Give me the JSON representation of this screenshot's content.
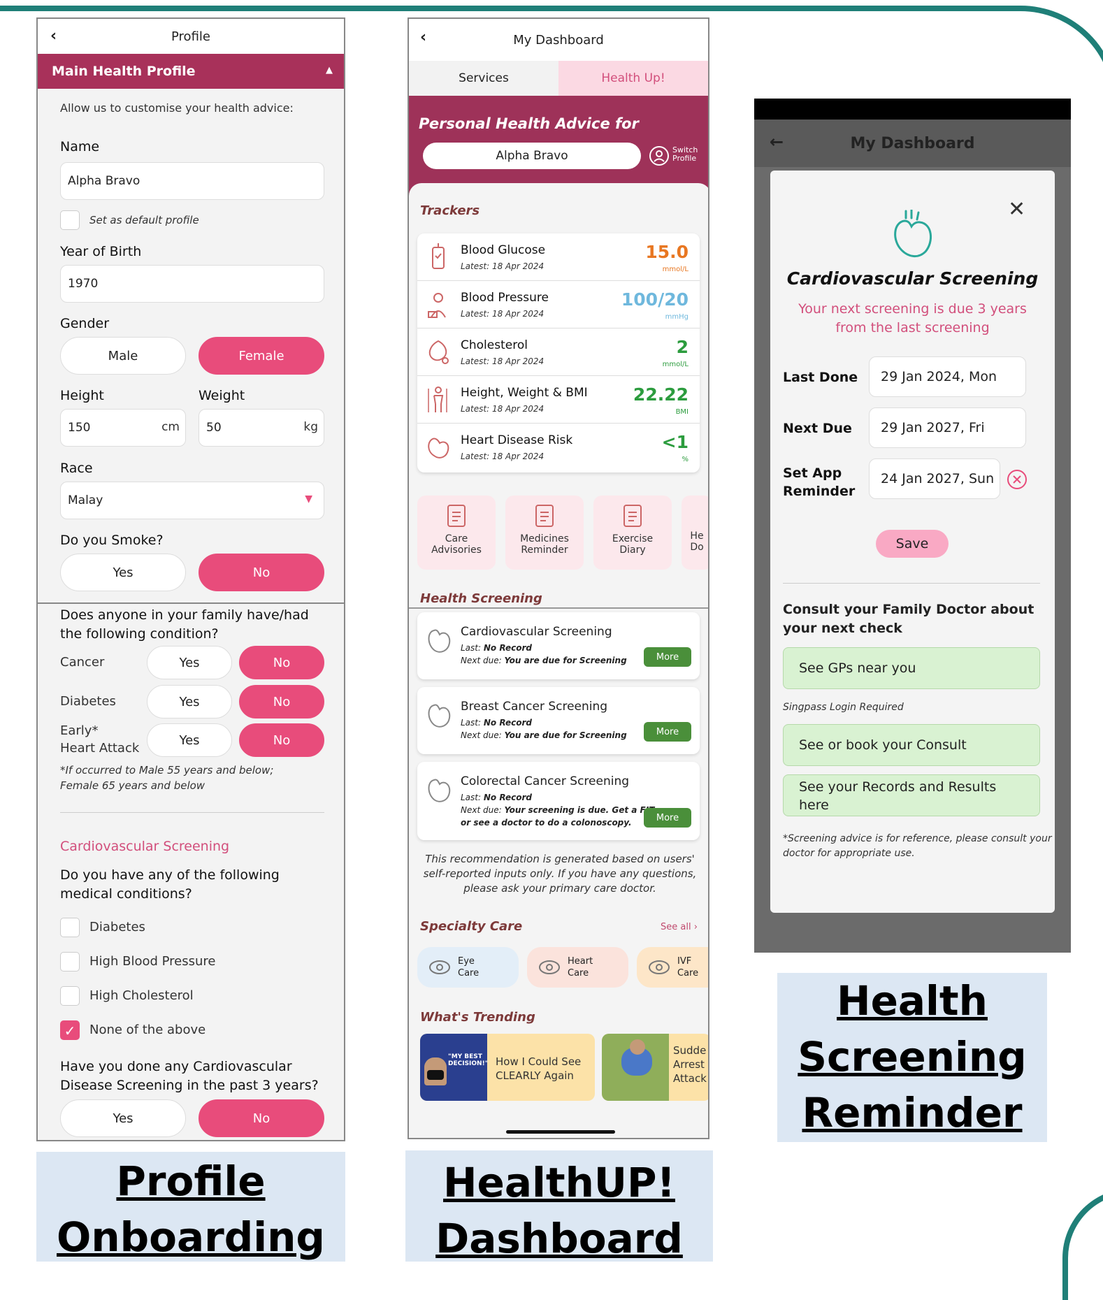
{
  "profile": {
    "title": "Profile",
    "section": "Main Health Profile",
    "intro": "Allow us to customise your health advice:",
    "name_label": "Name",
    "name_value": "Alpha Bravo",
    "default_label": "Set as default profile",
    "yob_label": "Year of Birth",
    "yob_value": "1970",
    "gender_label": "Gender",
    "gender_male": "Male",
    "gender_female": "Female",
    "height_label": "Height",
    "height_value": "150",
    "height_unit": "cm",
    "weight_label": "Weight",
    "weight_value": "50",
    "weight_unit": "kg",
    "race_label": "Race",
    "race_value": "Malay",
    "smoke_label": "Do you Smoke?",
    "yes": "Yes",
    "no": "No",
    "family_q": "Does anyone in your family have/had the following condition?",
    "fam_cancer": "Cancer",
    "fam_diabetes": "Diabetes",
    "fam_early": "Early*",
    "fam_heart": "Heart Attack",
    "fam_note1": "*If occurred to Male 55 years and below;",
    "fam_note2": "Female 65 years and below",
    "cv_title": "Cardiovascular Screening",
    "cond_q1": "Do you have any of the following",
    "cond_q2": "medical conditions?",
    "cond_diabetes": "Diabetes",
    "cond_hbp": "High Blood Pressure",
    "cond_chol": "High Cholesterol",
    "cond_none": "None of the above",
    "done_q1": "Have you done any Cardiovascular",
    "done_q2": "Disease Screening in the past 3 years?"
  },
  "captions": {
    "c1a": "Profile",
    "c1b": "Onboarding",
    "c2a": "HealthUP!",
    "c2b": "Dashboard",
    "c3a": "Health",
    "c3b": "Screening",
    "c3c": "Reminder"
  },
  "dashboard": {
    "title": "My Dashboard",
    "tab_services": "Services",
    "tab_healthup": "Health Up!",
    "advice_title": "Personal Health Advice for",
    "profile_name": "Alpha Bravo",
    "switch1": "Switch",
    "switch2": "Profile",
    "trackers_title": "Trackers",
    "trackers": [
      {
        "name": "Blood Glucose",
        "date": "Latest: 18 Apr 2024",
        "value": "15.0",
        "unit": "mmol/L",
        "color": "#e87722"
      },
      {
        "name": "Blood Pressure",
        "date": "Latest: 18 Apr 2024",
        "value": "100/20",
        "unit": "mmHg",
        "color": "#6fb8dd"
      },
      {
        "name": "Cholesterol",
        "date": "Latest: 18 Apr 2024",
        "value": "2",
        "unit": "mmol/L",
        "color": "#2c9c3e"
      },
      {
        "name": "Height, Weight & BMI",
        "date": "Latest: 18 Apr 2024",
        "value": "22.22",
        "unit": "BMI",
        "color": "#2c9c3e"
      },
      {
        "name": "Heart Disease Risk",
        "date": "Latest: 18 Apr 2024",
        "value": "<1",
        "unit": "%",
        "color": "#2c9c3e"
      }
    ],
    "tiles": [
      {
        "l1": "Care",
        "l2": "Advisories"
      },
      {
        "l1": "Medicines",
        "l2": "Reminder"
      },
      {
        "l1": "Exercise",
        "l2": "Diary"
      },
      {
        "l1": "He",
        "l2": "Do"
      }
    ],
    "screening_title": "Health Screening",
    "screenings": [
      {
        "name": "Cardiovascular Screening",
        "last_k": "Last:",
        "last_v": "No Record",
        "next_k": "Next due:",
        "next_v": "You are due for Screening",
        "next_v2": ""
      },
      {
        "name": "Breast Cancer Screening",
        "last_k": "Last:",
        "last_v": "No Record",
        "next_k": "Next due:",
        "next_v": "You are due for Screening",
        "next_v2": ""
      },
      {
        "name": "Colorectal Cancer Screening",
        "last_k": "Last:",
        "last_v": "No Record",
        "next_k": "Next due:",
        "next_v": "Your screening is due. Get a FIT",
        "next_v2": "or see a doctor to do a colonoscopy."
      }
    ],
    "more": "More",
    "disclaimer1": "This recommendation is generated based on users'",
    "disclaimer2": "self-reported inputs only. If you have any questions,",
    "disclaimer3": "please ask your primary care doctor.",
    "specialty_title": "Specialty Care",
    "see_all": "See all ›",
    "specialty": [
      {
        "l1": "Eye",
        "l2": "Care"
      },
      {
        "l1": "Heart",
        "l2": "Care"
      },
      {
        "l1": "IVF",
        "l2": "Care"
      }
    ],
    "trending_title": "What's Trending",
    "trend1_img1": "\"MY BEST",
    "trend1_img2": "DECISION!\"",
    "trend1_l1": "How I Could See",
    "trend1_l2": "CLEARLY Again",
    "trend2_l1": "Sudde",
    "trend2_l2": "Arrest",
    "trend2_l3": "Attack"
  },
  "reminder": {
    "title": "My Dashboard",
    "modal_title": "Cardiovascular Screening",
    "due1": "Your next screening is due 3 years",
    "due2": "from the last screening",
    "last_done_label": "Last Done",
    "last_done": "29 Jan 2024, Mon",
    "next_due_label": "Next Due",
    "next_due": "29 Jan 2027, Fri",
    "reminder_l1": "Set App",
    "reminder_l2": "Reminder",
    "reminder_value": "24 Jan 2027, Sun",
    "save": "Save",
    "consult1": "Consult your Family Doctor about",
    "consult2": "your next check",
    "gp": "See GPs near you",
    "singpass": "Singpass Login Required",
    "book": "See or book your Consult",
    "records1": "See your Records and Results",
    "records2": "here",
    "note1": "*Screening advice is for reference, please consult your",
    "note2": "doctor for appropriate use."
  }
}
